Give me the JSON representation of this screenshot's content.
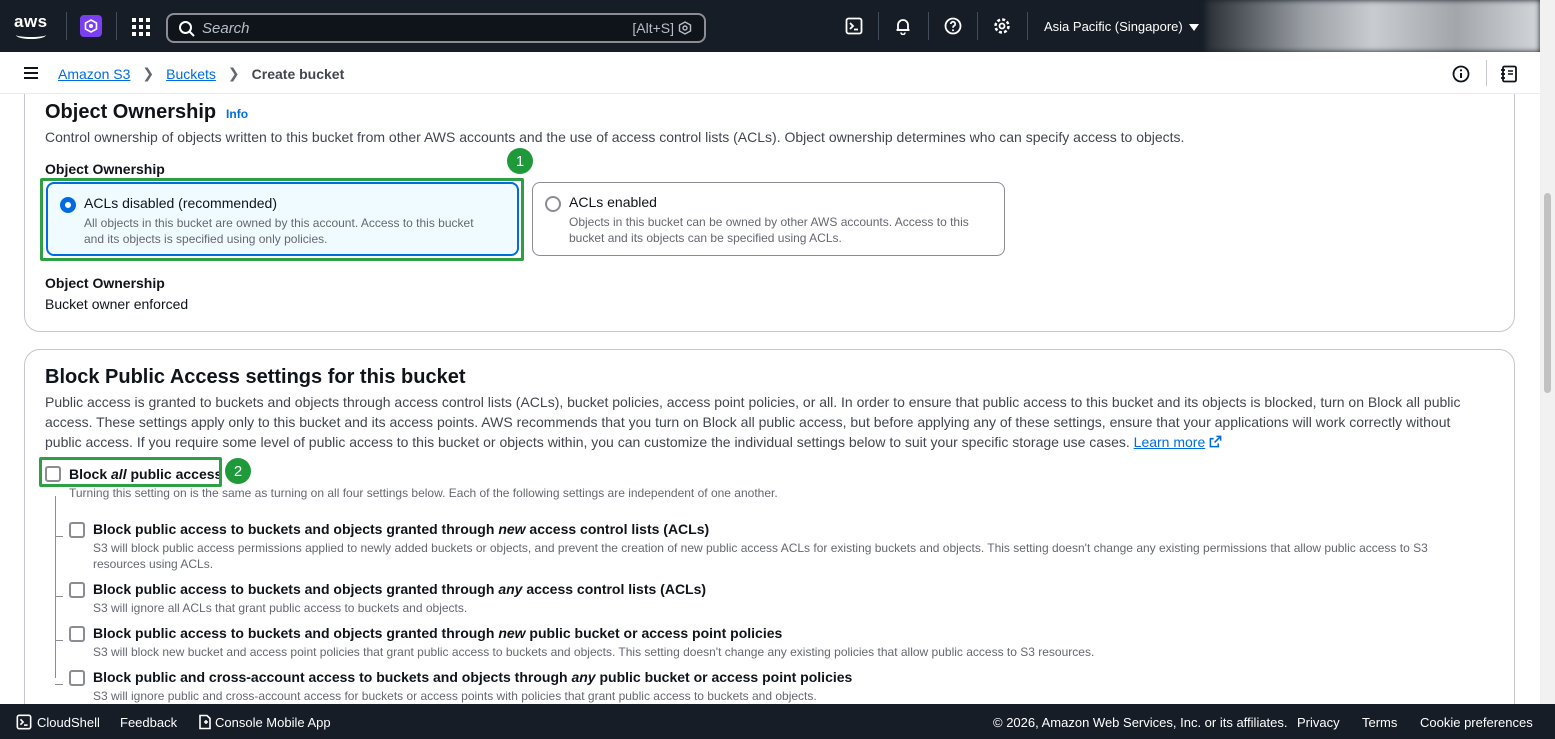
{
  "topnav": {
    "logo": "aws",
    "search_placeholder": "Search",
    "search_shortcut": "[Alt+S]",
    "region": "Asia Pacific (Singapore)"
  },
  "breadcrumb": {
    "items": [
      "Amazon S3",
      "Buckets"
    ],
    "current": "Create bucket"
  },
  "ownership": {
    "heading": "Object Ownership",
    "info": "Info",
    "description": "Control ownership of objects written to this bucket from other AWS accounts and the use of access control lists (ACLs). Object ownership determines who can specify access to objects.",
    "field_label": "Object Ownership",
    "options": [
      {
        "title": "ACLs disabled (recommended)",
        "desc_line1": "All objects in this bucket are owned by this account. Access to this bucket",
        "desc_line2": "and its objects is specified using only policies.",
        "selected": true
      },
      {
        "title": "ACLs enabled",
        "desc_line1": "Objects in this bucket can be owned by other AWS accounts. Access to this",
        "desc_line2": "bucket and its objects can be specified using ACLs.",
        "selected": false
      }
    ],
    "result_label": "Object Ownership",
    "result_value": "Bucket owner enforced"
  },
  "annotations": {
    "one": "1",
    "two": "2"
  },
  "block": {
    "heading": "Block Public Access settings for this bucket",
    "desc_line1": "Public access is granted to buckets and objects through access control lists (ACLs), bucket policies, access point policies, or all. In order to ensure that public access to this bucket and its objects is blocked, turn on Block all public",
    "desc_line2": "access. These settings apply only to this bucket and its access points. AWS recommends that you turn on Block all public access, but before applying any of these settings, ensure that your applications will work correctly without",
    "desc_line3": "public access. If you require some level of public access to this bucket or objects within, you can customize the individual settings below to suit your specific storage use cases.",
    "learn_more": "Learn more",
    "all": {
      "pre": "Block ",
      "em": "all",
      "post": " public access",
      "desc": "Turning this setting on is the same as turning on all four settings below. Each of the following settings are independent of one another."
    },
    "options": [
      {
        "pre": "Block public access to buckets and objects granted through ",
        "em": "new",
        "post": " access control lists (ACLs)",
        "desc1": "S3 will block public access permissions applied to newly added buckets or objects, and prevent the creation of new public access ACLs for existing buckets and objects. This setting doesn't change any existing permissions that allow public access to S3",
        "desc2": "resources using ACLs."
      },
      {
        "pre": "Block public access to buckets and objects granted through ",
        "em": "any",
        "post": " access control lists (ACLs)",
        "desc1": "S3 will ignore all ACLs that grant public access to buckets and objects."
      },
      {
        "pre": "Block public access to buckets and objects granted through ",
        "em": "new",
        "post": " public bucket or access point policies",
        "desc1": "S3 will block new bucket and access point policies that grant public access to buckets and objects. This setting doesn't change any existing policies that allow public access to S3 resources."
      },
      {
        "pre": "Block public and cross-account access to buckets and objects through ",
        "em": "any",
        "post": " public bucket or access point policies",
        "desc1": "S3 will ignore public and cross-account access for buckets or access points with policies that grant public access to buckets and objects."
      }
    ]
  },
  "footer": {
    "cloudshell": "CloudShell",
    "feedback": "Feedback",
    "mobile_app": "Console Mobile App",
    "copyright": "© 2026, Amazon Web Services, Inc. or its affiliates.",
    "privacy": "Privacy",
    "terms": "Terms",
    "cookies": "Cookie preferences"
  },
  "colors": {
    "nav_bg": "#161d26",
    "link": "#006ce0",
    "annotation_green": "#2ea043"
  }
}
